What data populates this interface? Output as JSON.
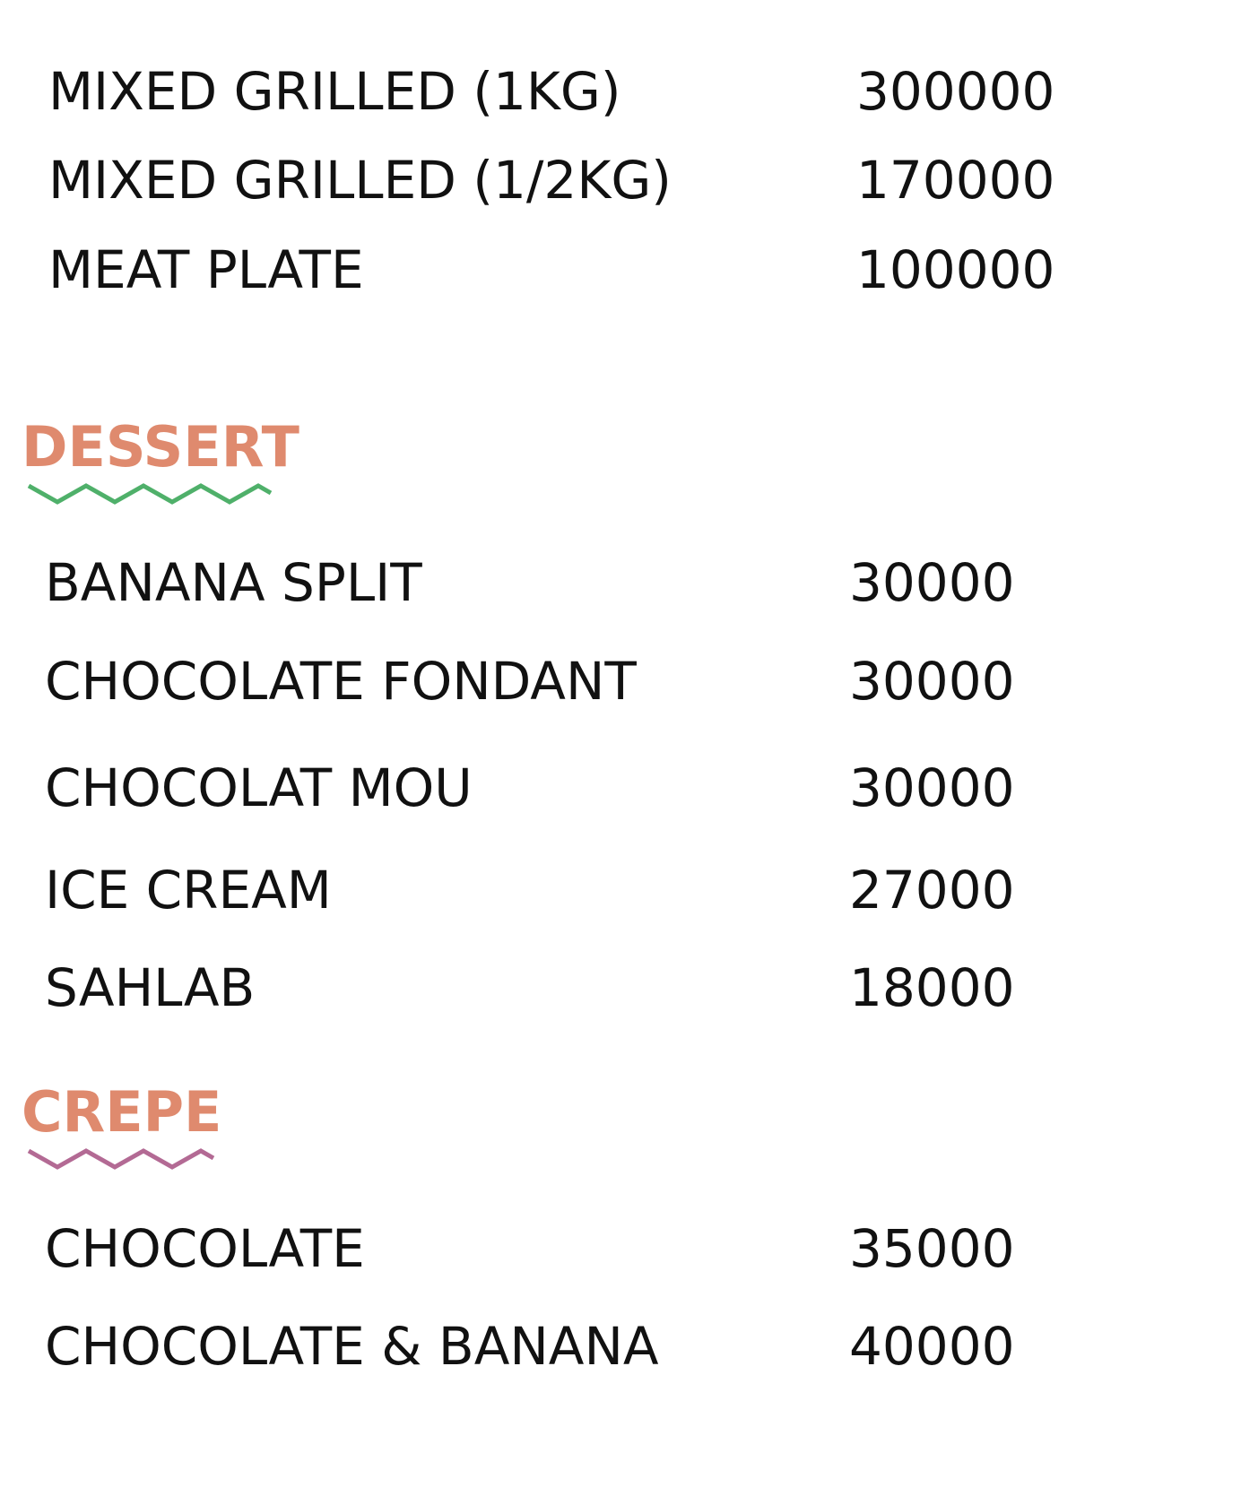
{
  "colors": {
    "text": "#111111",
    "heading": "#df8a6e",
    "dessert_squiggle": "#4fb06a",
    "crepe_squiggle": "#b36a94"
  },
  "grill": {
    "items": [
      {
        "name": "MIXED GRILLED (1KG)",
        "price": "300000"
      },
      {
        "name": "MIXED GRILLED (1/2KG)",
        "price": "170000"
      },
      {
        "name": "MEAT PLATE",
        "price": "100000"
      }
    ]
  },
  "dessert": {
    "title": "DESSERT",
    "items": [
      {
        "name": "BANANA SPLIT",
        "price": "30000"
      },
      {
        "name": "CHOCOLATE FONDANT",
        "price": "30000"
      },
      {
        "name": "CHOCOLAT MOU",
        "price": "30000"
      },
      {
        "name": "ICE CREAM",
        "price": "27000"
      },
      {
        "name": "SAHLAB",
        "price": "18000"
      }
    ]
  },
  "crepe": {
    "title": "CREPE",
    "items": [
      {
        "name": "CHOCOLATE",
        "price": "35000"
      },
      {
        "name": "CHOCOLATE & BANANA",
        "price": "40000"
      }
    ]
  }
}
